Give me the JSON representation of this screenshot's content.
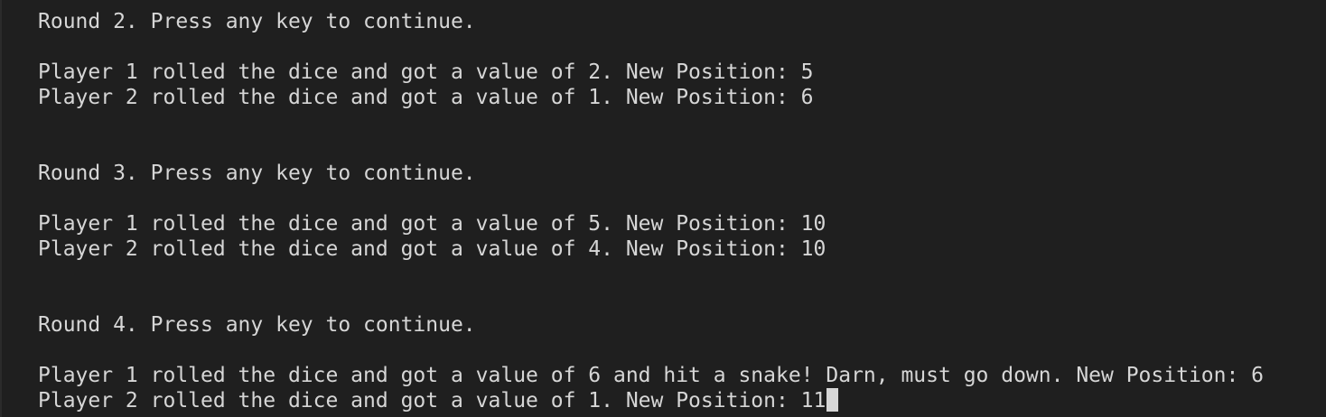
{
  "theme": {
    "background": "#1f1f1f",
    "foreground": "#d6d6d6",
    "cursor": "#d6d6d6"
  },
  "terminal": {
    "lines": [
      "Round 2. Press any key to continue.",
      "",
      "Player 1 rolled the dice and got a value of 2. New Position: 5",
      "Player 2 rolled the dice and got a value of 1. New Position: 6",
      "",
      "",
      "Round 3. Press any key to continue.",
      "",
      "Player 1 rolled the dice and got a value of 5. New Position: 10",
      "Player 2 rolled the dice and got a value of 4. New Position: 10",
      "",
      "",
      "Round 4. Press any key to continue.",
      "",
      "Player 1 rolled the dice and got a value of 6 and hit a snake! Darn, must go down. New Position: 6",
      "Player 2 rolled the dice and got a value of 1. New Position: 11"
    ]
  }
}
